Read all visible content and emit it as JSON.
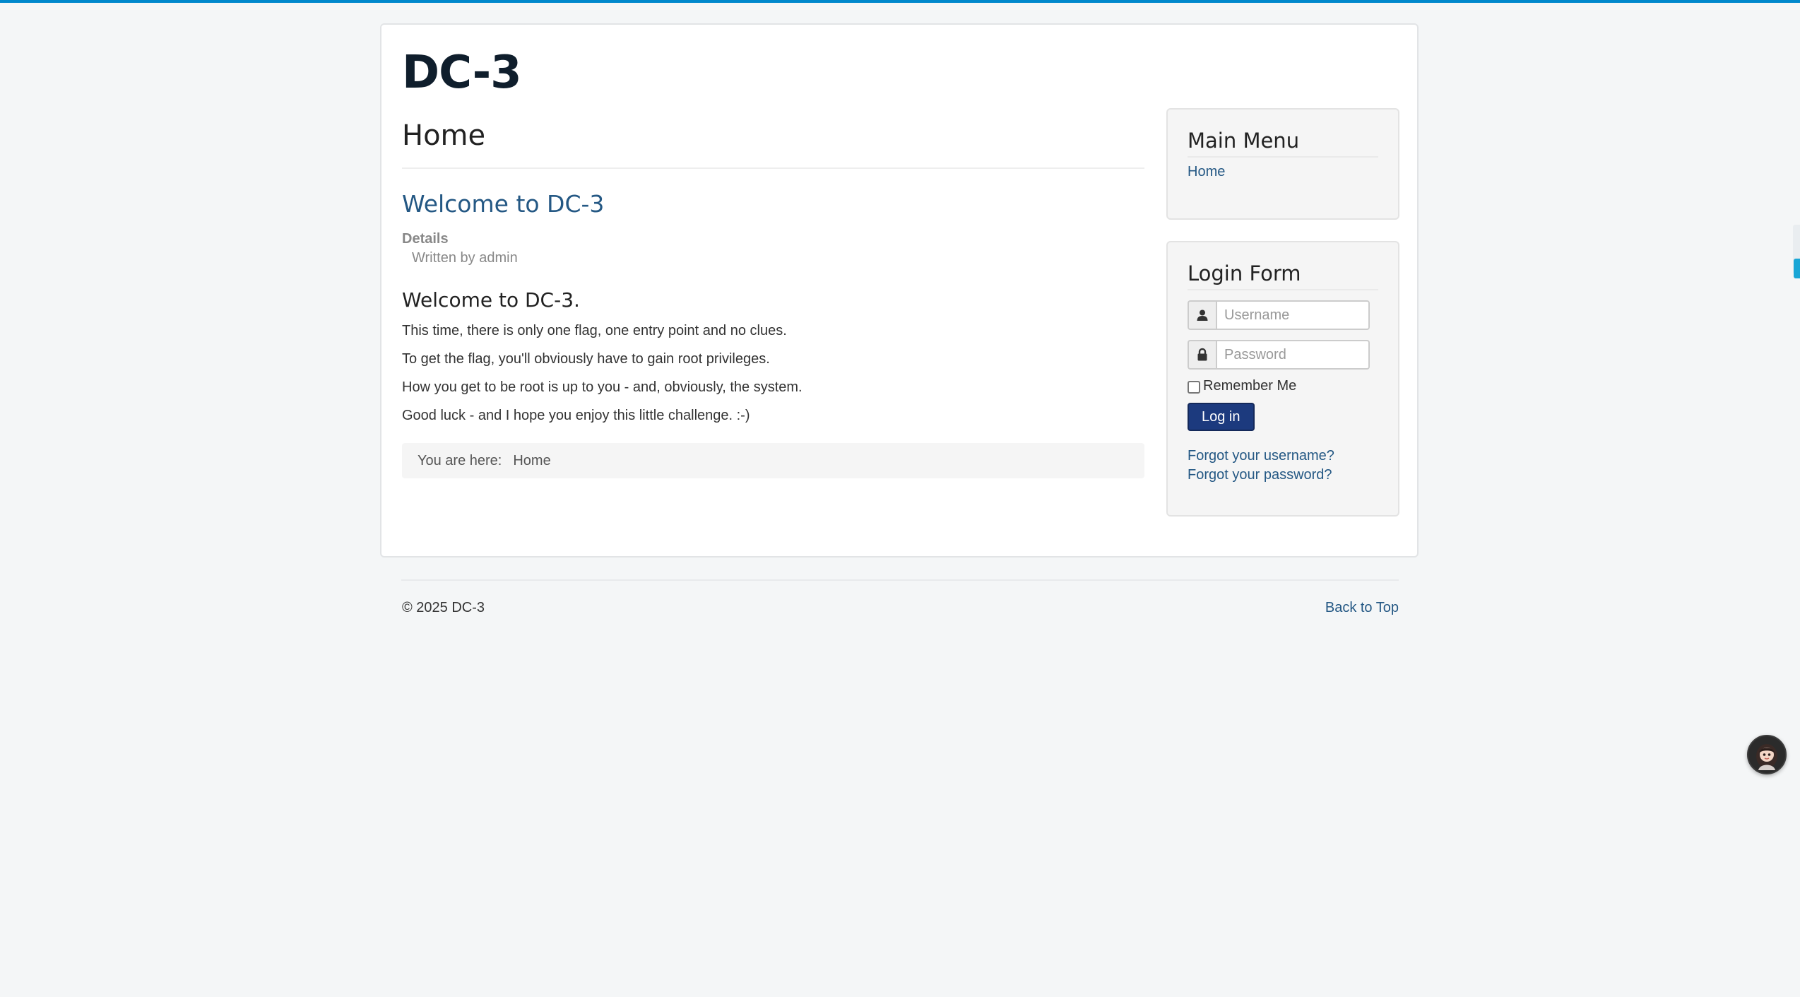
{
  "site": {
    "title": "DC-3"
  },
  "main": {
    "page_heading": "Home",
    "article": {
      "title": "Welcome to DC-3",
      "details_label": "Details",
      "author_line": "Written by admin",
      "subheading": "Welcome to DC-3.",
      "paragraphs": [
        "This time, there is only one flag, one entry point and no clues.",
        "To get the flag, you'll obviously have to gain root privileges.",
        "How you get to be root is up to you - and, obviously, the system.",
        "Good luck - and I hope you enjoy this little challenge.  :-)"
      ]
    },
    "breadcrumb": {
      "label": "You are here:",
      "current": "Home"
    }
  },
  "sidebar": {
    "main_menu": {
      "title": "Main Menu",
      "items": [
        {
          "label": "Home"
        }
      ]
    },
    "login_form": {
      "title": "Login Form",
      "username_placeholder": "Username",
      "password_placeholder": "Password",
      "username_value": "",
      "password_value": "",
      "remember_label": "Remember Me",
      "remember_checked": false,
      "submit_label": "Log in",
      "forgot_username": "Forgot your username?",
      "forgot_password": "Forgot your password?",
      "icons": [
        "user-icon",
        "lock-icon"
      ]
    }
  },
  "footer": {
    "copyright": "© 2025 DC-3",
    "back_to_top": "Back to Top"
  },
  "colors": {
    "link": "#245884",
    "button": "#1c3a7e",
    "top_bar": "#0088cc",
    "page_background": "#f4f6f7"
  }
}
